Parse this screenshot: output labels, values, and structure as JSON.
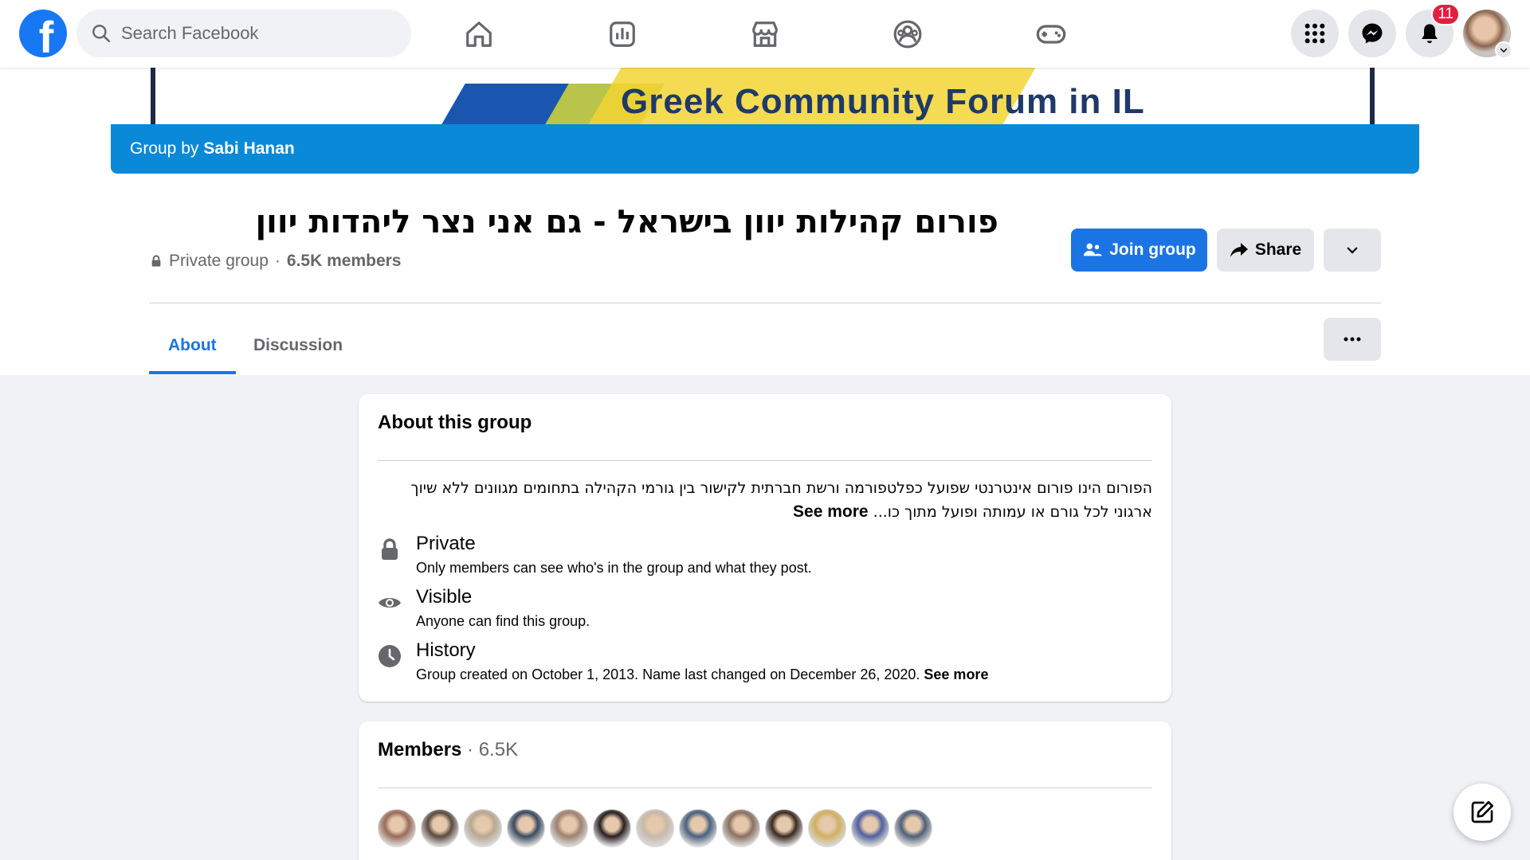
{
  "colors": {
    "brand": "#1877f2",
    "accent": "#1b74e4",
    "group_bar": "#0a89d8",
    "badge": "#e41e3f"
  },
  "topbar": {
    "search_placeholder": "Search Facebook",
    "nav_icons": [
      "home-icon",
      "pages-icon",
      "marketplace-icon",
      "groups-icon",
      "gaming-icon"
    ],
    "right_icons": [
      "menu-grid-icon",
      "messenger-icon",
      "notifications-icon"
    ],
    "notification_count": "11"
  },
  "cover": {
    "banner_text": "Greek Community Forum in IL"
  },
  "group": {
    "by_prefix": "Group by",
    "by_name": "Sabi Hanan",
    "title": "פורום קהילות יוון בישראל - גם אני נצר ליהדות יוון",
    "privacy": "Private group",
    "separator": "·",
    "members": "6.5K members",
    "join_label": "Join group",
    "share_label": "Share"
  },
  "tabs": [
    {
      "label": "About",
      "active": true
    },
    {
      "label": "Discussion",
      "active": false
    }
  ],
  "about": {
    "heading": "About this group",
    "description_line1": "הפורום הינו פורום אינטרנטי שפועל כפלטפורמה ורשת חברתית לקישור בין גורמי הקהילה בתחומים מגוונים ללא שיוך",
    "description_line2": "ארגוני לכל גורם או עמותה ופועל מתוך כו...",
    "see_more": "See more",
    "private_title": "Private",
    "private_sub": "Only members can see who's in the group and what they post.",
    "visible_title": "Visible",
    "visible_sub": "Anyone can find this group.",
    "history_title": "History",
    "history_sub": "Group created on October 1, 2013. Name last changed on December 26, 2020.",
    "history_see_more": "See more"
  },
  "members_card": {
    "heading": "Members",
    "separator": " · ",
    "count": "6.5K",
    "avatar_colors": [
      "#9a6b5a",
      "#5a4a40",
      "#b8a890",
      "#3a4a60",
      "#a08070",
      "#2a2020",
      "#c8b8a8",
      "#4a6080",
      "#8a7060",
      "#3a2a20",
      "#d0b060",
      "#5060a0",
      "#506078"
    ]
  }
}
